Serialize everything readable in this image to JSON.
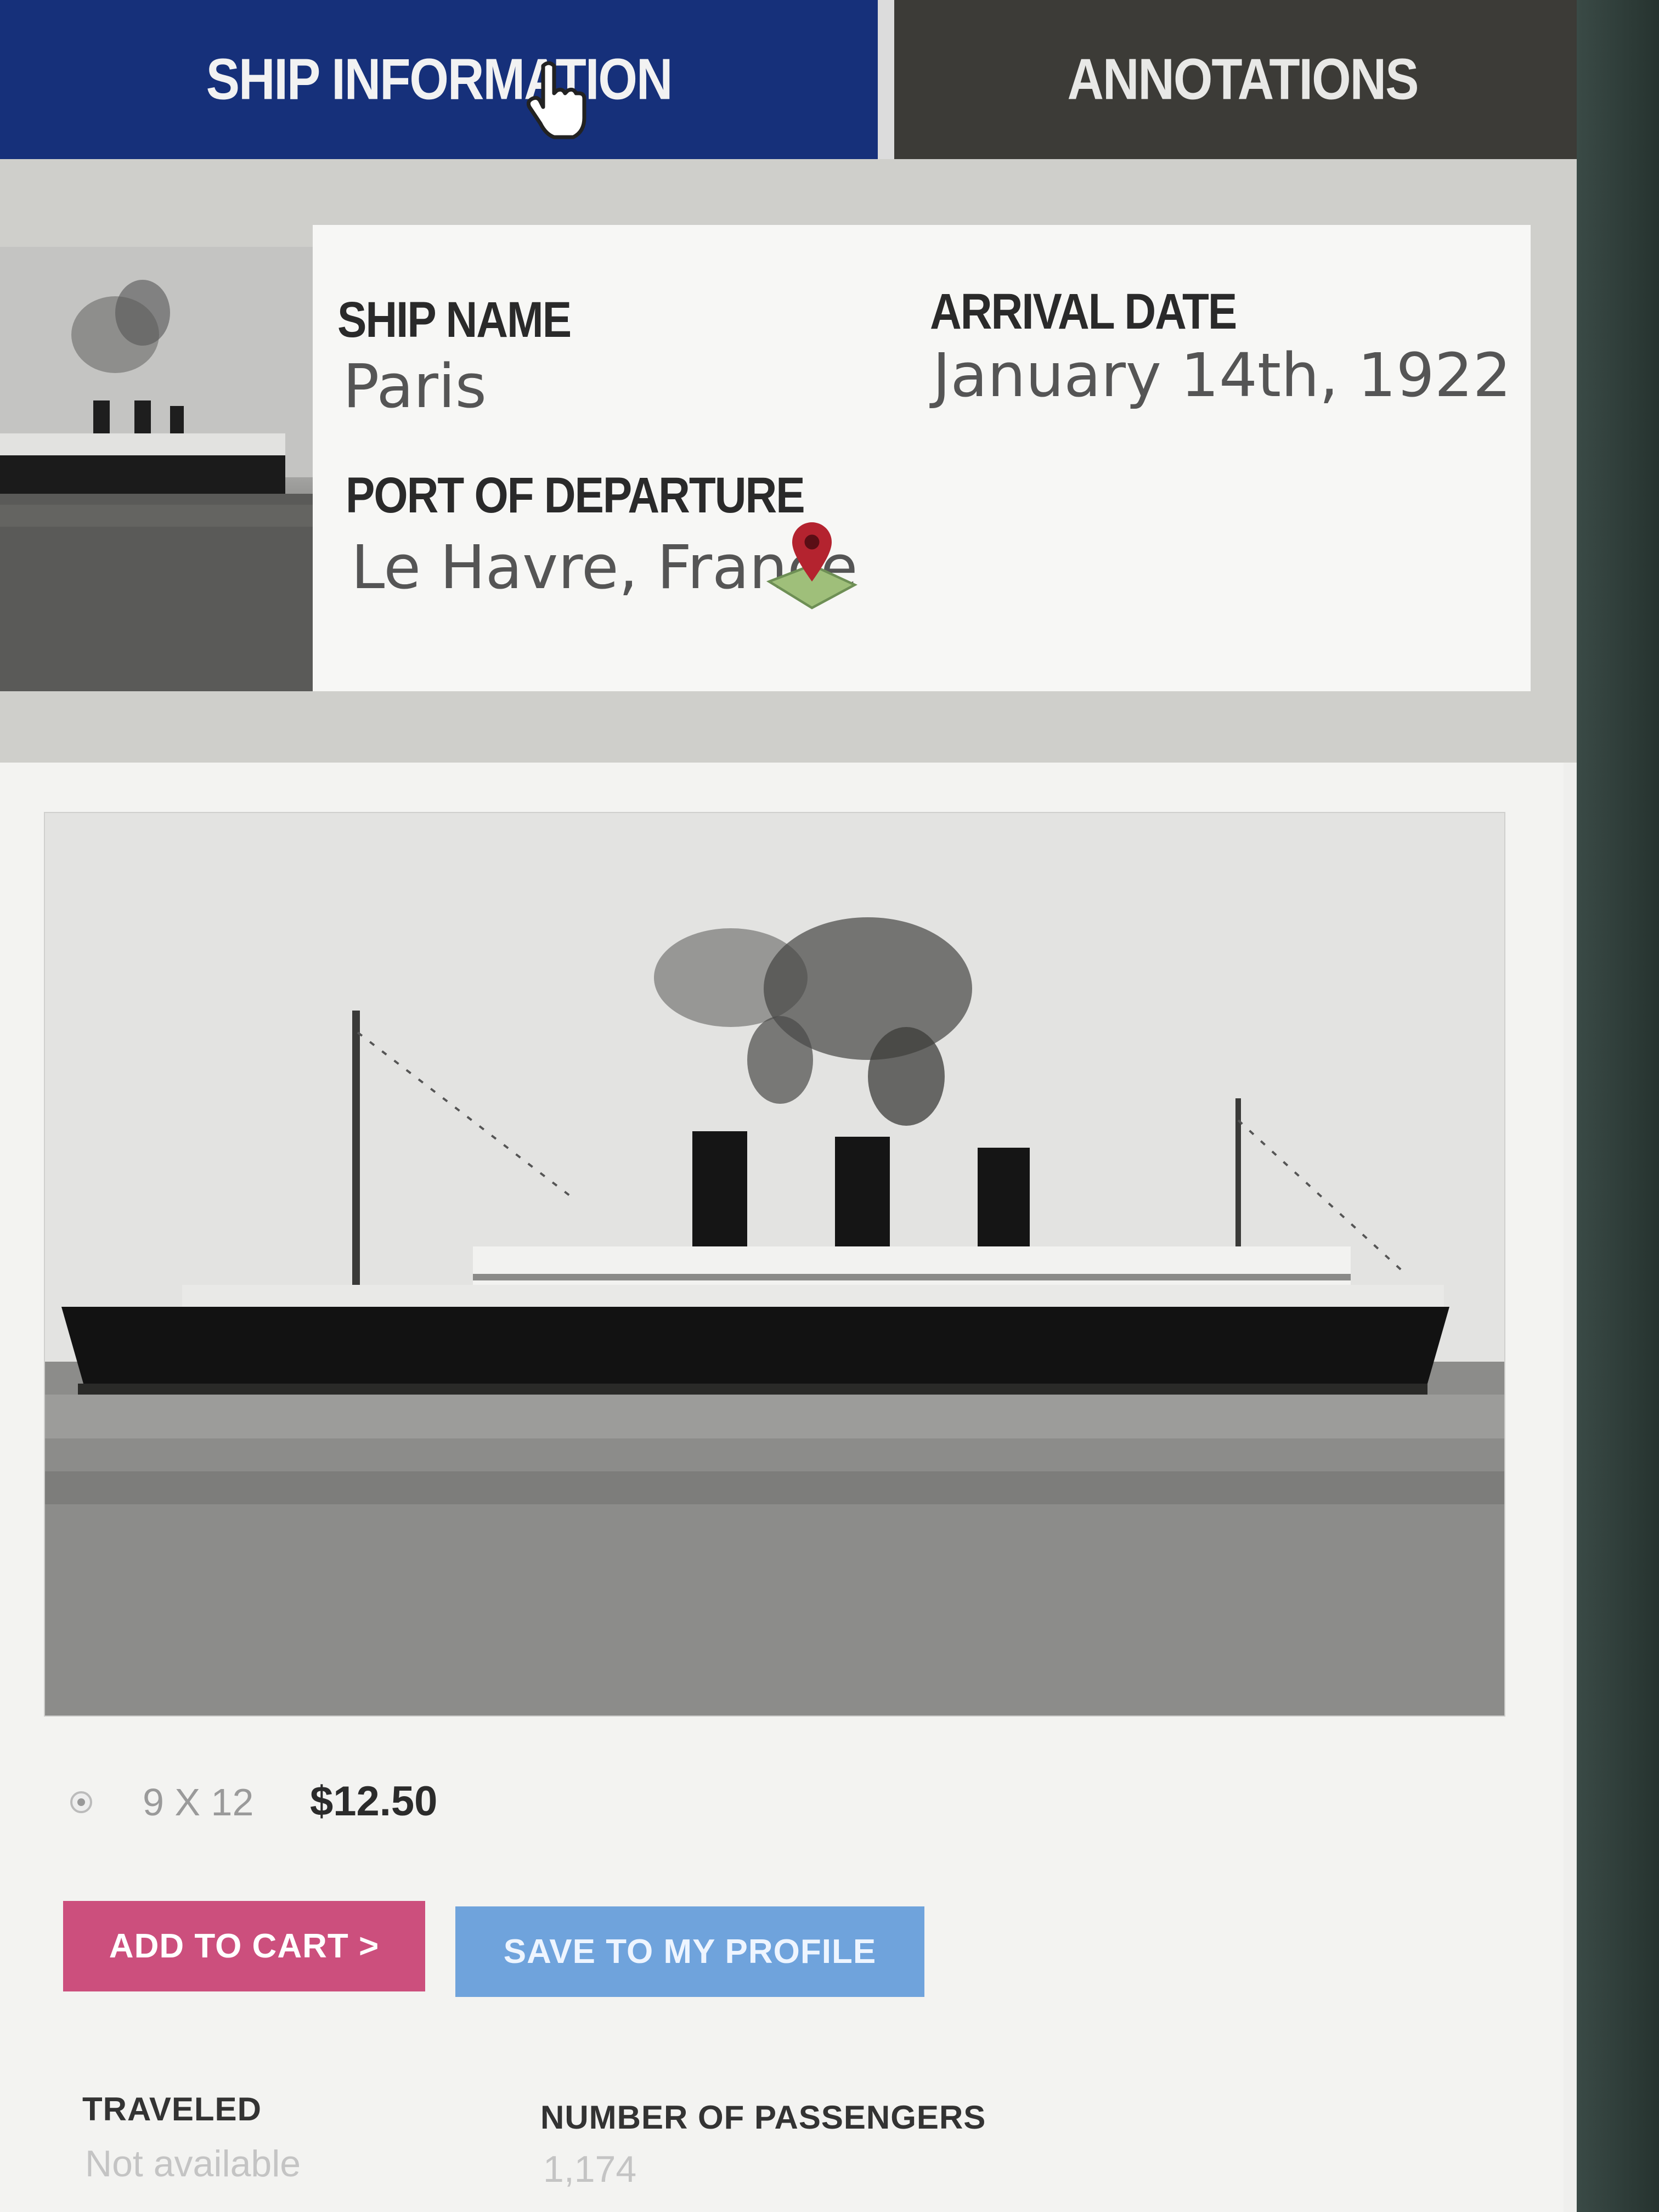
{
  "tabs": {
    "ship_information": "SHIP INFORMATION",
    "annotations": "ANNOTATIONS"
  },
  "ship": {
    "name_label": "SHIP NAME",
    "name": "Paris",
    "arrival_label": "ARRIVAL DATE",
    "arrival_date": "January 14th, 1922",
    "departure_label": "PORT OF DEPARTURE",
    "departure": "Le Havre, France"
  },
  "print": {
    "size": "9 X 12",
    "price": "$12.50"
  },
  "buttons": {
    "add_to_cart": "ADD TO CART >",
    "save_to_profile": "SAVE TO MY PROFILE"
  },
  "details": {
    "traveled_label": "TRAVELED",
    "traveled": "Not available",
    "passengers_label": "NUMBER OF PASSENGERS",
    "passengers": "1,174"
  },
  "colors": {
    "tab_active": "#16307a",
    "tab_inactive": "#3c3b37",
    "cart_button": "#cc4f7d",
    "save_button": "#6fa3dc"
  }
}
